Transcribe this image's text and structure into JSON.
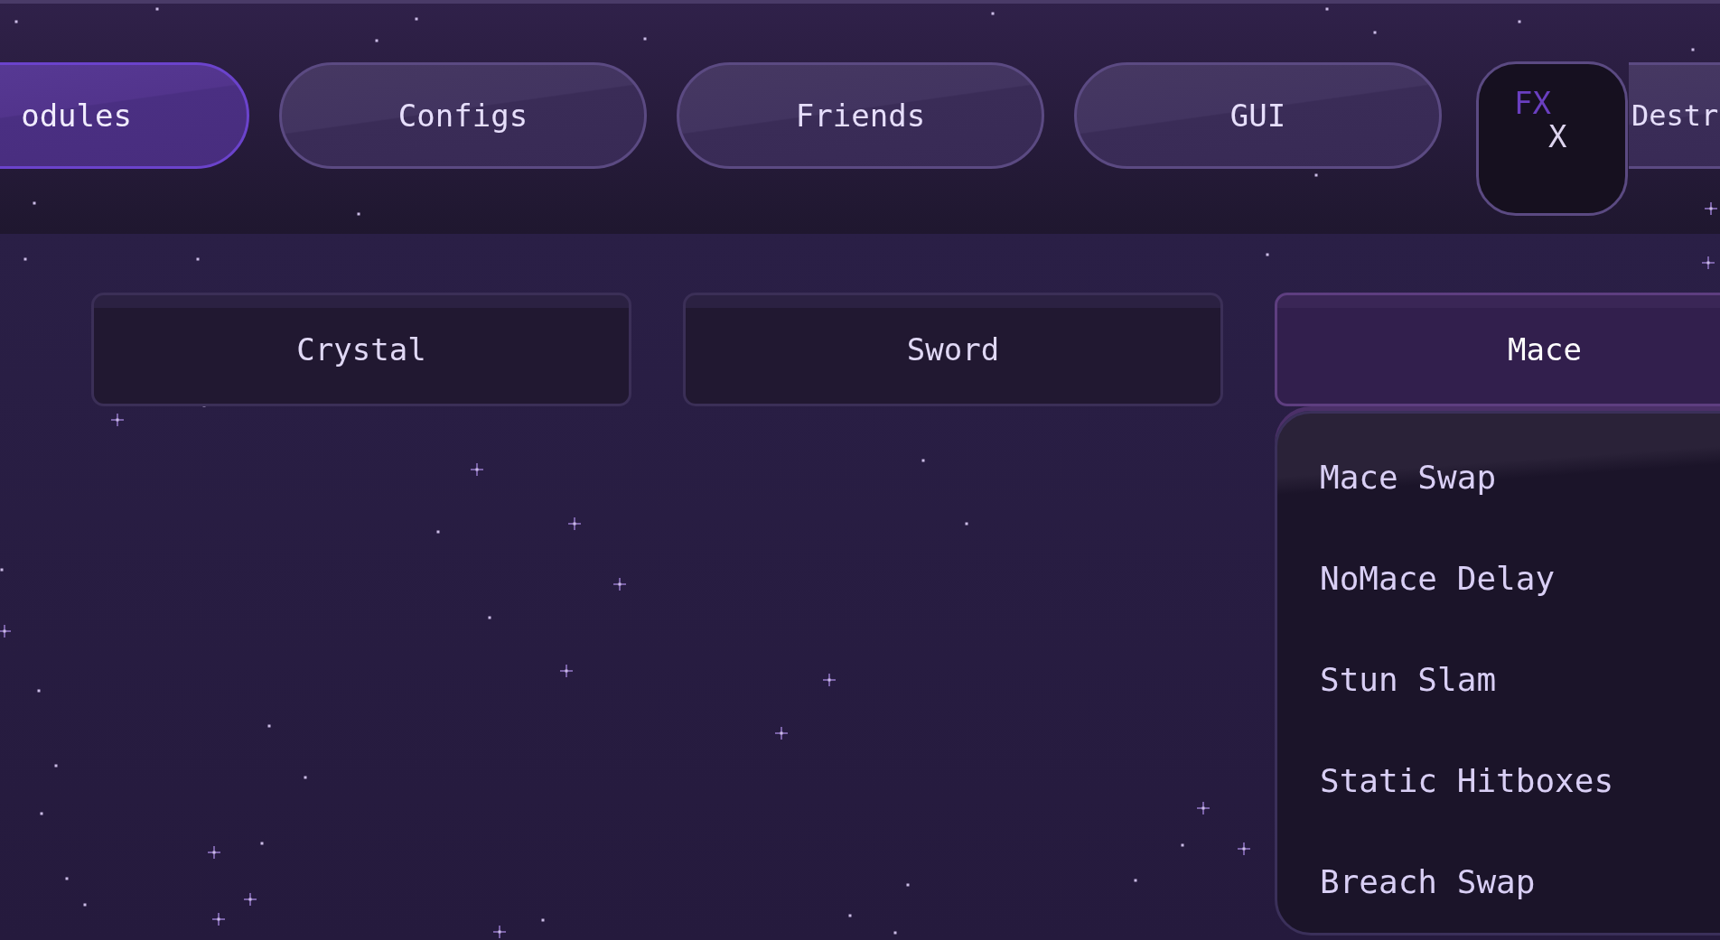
{
  "tabs": [
    {
      "label": "odules",
      "selected": true
    },
    {
      "label": "Configs",
      "selected": false
    },
    {
      "label": "Friends",
      "selected": false
    },
    {
      "label": "GUI",
      "selected": false
    },
    {
      "label": "Destr",
      "selected": false
    }
  ],
  "fx_widget": {
    "label": "FX",
    "close": "X"
  },
  "categories": [
    {
      "label": "Crystal",
      "selected": false
    },
    {
      "label": "Sword",
      "selected": false
    },
    {
      "label": "Mace",
      "selected": true,
      "modules": [
        "Mace Swap",
        "NoMace Delay",
        "Stun Slam",
        "Static Hitboxes",
        "Breach Swap"
      ]
    }
  ]
}
